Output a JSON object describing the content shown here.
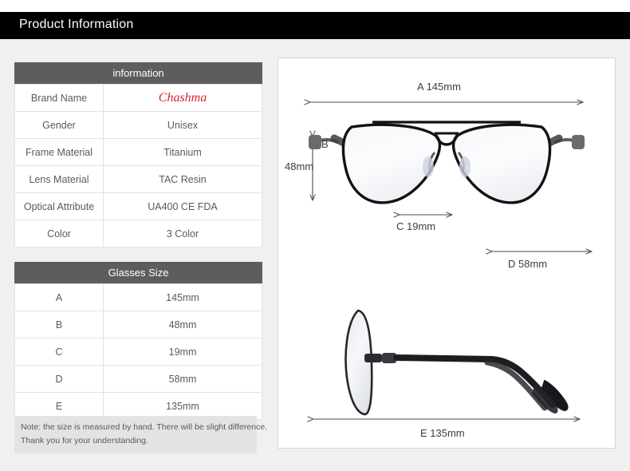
{
  "header": {
    "title": "Product Information"
  },
  "info_table": {
    "caption": "information",
    "rows": [
      {
        "key": "Brand Name",
        "value": "Chashma",
        "style": "brand"
      },
      {
        "key": "Gender",
        "value": "Unisex"
      },
      {
        "key": "Frame Material",
        "value": "Titanium"
      },
      {
        "key": "Lens Material",
        "value": "TAC Resin"
      },
      {
        "key": "Optical Attribute",
        "value": "UA400 CE FDA"
      },
      {
        "key": "Color",
        "value": "3 Color"
      }
    ]
  },
  "size_table": {
    "caption": "Glasses Size",
    "rows": [
      {
        "key": "A",
        "value": "145mm"
      },
      {
        "key": "B",
        "value": "48mm"
      },
      {
        "key": "C",
        "value": "19mm"
      },
      {
        "key": "D",
        "value": "58mm"
      },
      {
        "key": "E",
        "value": "135mm"
      }
    ]
  },
  "note": {
    "line1": "Note: the size is measured by hand. There will be slight difference.",
    "line2": "Thank you for your understanding."
  },
  "diagram": {
    "front_view": {
      "icon": "eyeglasses-front-icon",
      "labels": {
        "a": "A 145mm",
        "b_letter": "B",
        "b_value": "48mm",
        "c": "C 19mm",
        "d": "D 58mm"
      }
    },
    "side_view": {
      "icon": "eyeglasses-side-icon",
      "labels": {
        "e": "E 135mm"
      }
    }
  },
  "colors": {
    "header_bg": "#000000",
    "header_text": "#ffffff",
    "table_caption_bg": "#5d5d5d",
    "brand_red": "#d8252a",
    "page_bg": "#f0f0f0",
    "note_bg": "#e3e3e3"
  }
}
